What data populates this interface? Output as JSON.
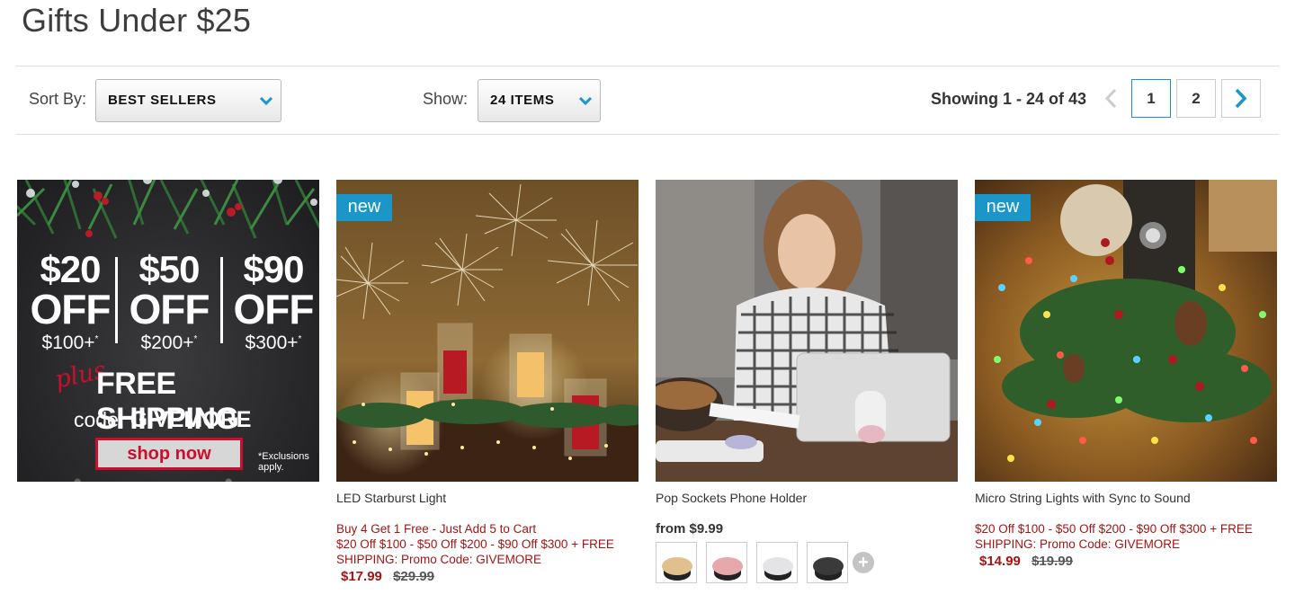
{
  "page": {
    "title": "Gifts Under $25"
  },
  "toolbar": {
    "sort_label": "Sort By:",
    "sort_value": "BEST SELLERS",
    "show_label": "Show:",
    "show_value": "24 ITEMS",
    "showing_text": "Showing 1 - 24 of 43",
    "pages": [
      "1",
      "2"
    ],
    "current_page": "1"
  },
  "promo_banner": {
    "tiers": [
      {
        "amount": "$20",
        "word": "OFF",
        "minimum": "$100+"
      },
      {
        "amount": "$50",
        "word": "OFF",
        "minimum": "$200+"
      },
      {
        "amount": "$90",
        "word": "OFF",
        "minimum": "$300+"
      }
    ],
    "asterisk": "*",
    "plus": "plus",
    "free_shipping": "FREE SHIPPING",
    "code_label": "code:",
    "code": "GIVEMORE",
    "cta": "shop now",
    "exclusions": [
      "*Exclusions",
      "apply."
    ]
  },
  "products": [
    {
      "name": "LED Starburst Light",
      "badge": "new",
      "promo_lines": [
        "Buy 4 Get 1 Free - Just Add 5 to Cart",
        "$20 Off $100 - $50 Off $200 - $90 Off $300 + FREE",
        "SHIPPING: Promo Code: GIVEMORE"
      ],
      "sale_price": "$17.99",
      "original_price": "$29.99"
    },
    {
      "name": "Pop Sockets Phone Holder",
      "from_price": "from $9.99",
      "swatch_colors": [
        "#e2c08e",
        "#e6a8aa",
        "#e4e4e6",
        "#3a3a3a"
      ],
      "more_swatches": "+"
    },
    {
      "name": "Micro String Lights with Sync to Sound",
      "badge": "new",
      "promo_lines": [
        "$20 Off $100 - $50 Off $200 - $90 Off $300 + FREE",
        "SHIPPING: Promo Code: GIVEMORE"
      ],
      "sale_price": "$14.99",
      "original_price": "$19.99"
    }
  ],
  "colors": {
    "accent": "#1a96c8",
    "sale": "#a31515",
    "promo_red": "#c8102e"
  },
  "icons": {
    "select_chevron": "chevron-down-icon",
    "prev": "chevron-left-icon",
    "next": "chevron-right-icon"
  }
}
